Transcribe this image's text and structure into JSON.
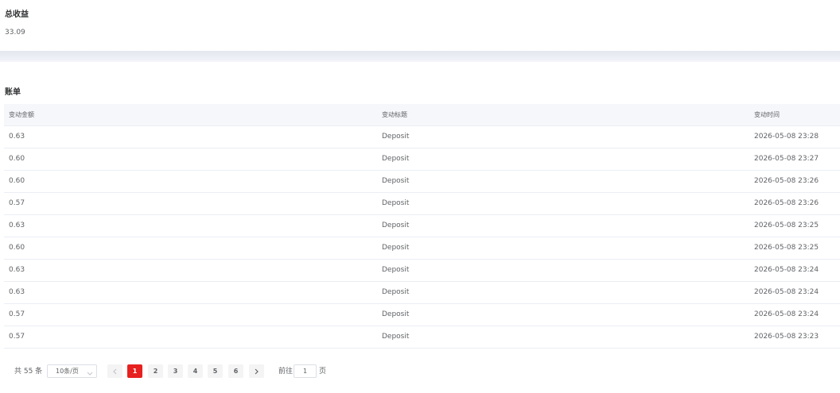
{
  "summary": {
    "title": "总收益",
    "value": "33.09"
  },
  "bill": {
    "title": "账单",
    "columns": [
      "变动金额",
      "变动标题",
      "变动时间"
    ],
    "rows": [
      [
        "0.63",
        "Deposit",
        "2026-05-08 23:28"
      ],
      [
        "0.60",
        "Deposit",
        "2026-05-08 23:27"
      ],
      [
        "0.60",
        "Deposit",
        "2026-05-08 23:26"
      ],
      [
        "0.57",
        "Deposit",
        "2026-05-08 23:26"
      ],
      [
        "0.63",
        "Deposit",
        "2026-05-08 23:25"
      ],
      [
        "0.60",
        "Deposit",
        "2026-05-08 23:25"
      ],
      [
        "0.63",
        "Deposit",
        "2026-05-08 23:24"
      ],
      [
        "0.63",
        "Deposit",
        "2026-05-08 23:24"
      ],
      [
        "0.57",
        "Deposit",
        "2026-05-08 23:24"
      ],
      [
        "0.57",
        "Deposit",
        "2026-05-08 23:23"
      ]
    ]
  },
  "pagination": {
    "total_text": "共 55 条",
    "page_size": "10条/页",
    "pages": [
      "1",
      "2",
      "3",
      "4",
      "5",
      "6"
    ],
    "current_page": "1",
    "goto_label": "前往",
    "goto_value": "1",
    "goto_unit": "页",
    "prev_icon": "chevron-left-icon",
    "next_icon": "chevron-right-icon",
    "active_color": "#e6211f"
  }
}
